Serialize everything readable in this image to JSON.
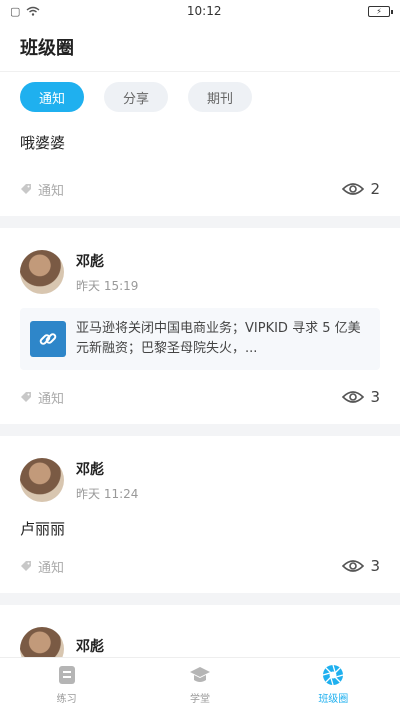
{
  "status_bar": {
    "time": "10:12",
    "battery_icon": "battery-icon",
    "wifi_icon": "wifi-icon"
  },
  "header": {
    "title": "班级圈"
  },
  "tabs": [
    {
      "label": "通知",
      "active": true
    },
    {
      "label": "分享",
      "active": false
    },
    {
      "label": "期刊",
      "active": false
    }
  ],
  "feed": {
    "partial_post": {
      "text": "哦婆婆",
      "tag": "通知",
      "views": "2"
    },
    "posts": [
      {
        "author": "邓彪",
        "time": "昨天 15:19",
        "link_text": "亚马逊将关闭中国电商业务；VIPKID 寻求 5 亿美元新融资；巴黎圣母院失火，...",
        "tag": "通知",
        "views": "3"
      },
      {
        "author": "邓彪",
        "time": "昨天 11:24",
        "text": "卢丽丽",
        "tag": "通知",
        "views": "3"
      },
      {
        "author": "邓彪"
      }
    ]
  },
  "bottom_nav": [
    {
      "label": "练习",
      "icon": "document-icon",
      "active": false
    },
    {
      "label": "学堂",
      "icon": "graduation-cap-icon",
      "active": false
    },
    {
      "label": "班级圈",
      "icon": "aperture-icon",
      "active": true
    }
  ],
  "colors": {
    "accent": "#1fb0ef",
    "link_icon_bg": "#2e86c9"
  }
}
